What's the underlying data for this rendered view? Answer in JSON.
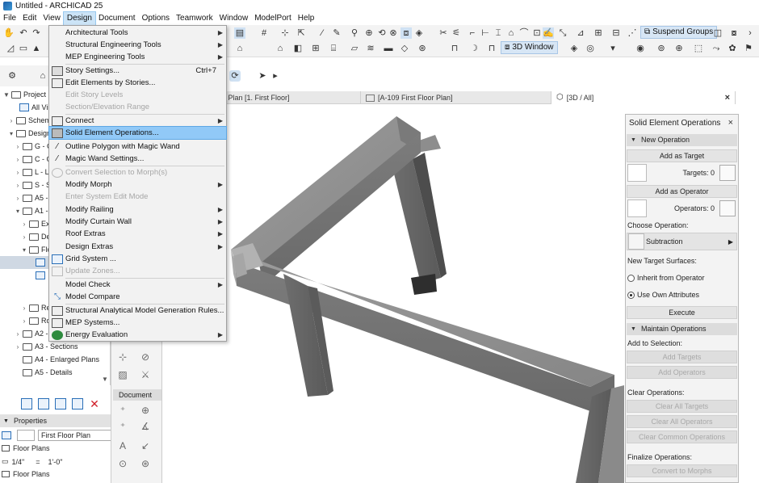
{
  "window": {
    "title": "Untitled - ARCHICAD 25"
  },
  "menubar": [
    "File",
    "Edit",
    "View",
    "Design",
    "Document",
    "Options",
    "Teamwork",
    "Window",
    "ModelPort",
    "Help"
  ],
  "menubar_active": "Design",
  "toolbar": {
    "suspend_groups": "Suspend Groups",
    "window_3d": "3D Window"
  },
  "design_menu": {
    "architectural_tools": "Architectural Tools",
    "structural_engineering_tools": "Structural Engineering Tools",
    "mep_engineering_tools": "MEP Engineering Tools",
    "story_settings": "Story Settings...",
    "story_settings_shortcut": "Ctrl+7",
    "edit_elements_by_stories": "Edit Elements by Stories...",
    "edit_story_levels": "Edit Story Levels",
    "section_elevation_range": "Section/Elevation Range",
    "connect": "Connect",
    "solid_element_operations": "Solid Element Operations...",
    "outline_polygon": "Outline Polygon with Magic Wand",
    "magic_wand_settings": "Magic Wand Settings...",
    "convert_selection_to_morphs": "Convert Selection to Morph(s)",
    "modify_morph": "Modify Morph",
    "enter_system_edit_mode": "Enter System Edit Mode",
    "modify_railing": "Modify Railing",
    "modify_curtain_wall": "Modify Curtain Wall",
    "roof_extras": "Roof Extras",
    "design_extras": "Design Extras",
    "grid_system": "Grid System ...",
    "update_zones": "Update Zones...",
    "model_check": "Model Check",
    "model_compare": "Model Compare",
    "structural_analytical": "Structural Analytical Model Generation Rules...",
    "mep_systems": "MEP Systems...",
    "energy_evaluation": "Energy Evaluation"
  },
  "navigator": {
    "rows": [
      "Project M",
      "All Visi",
      "Schem",
      "Design",
      "G - C",
      "C - C",
      "L - L",
      "S - S",
      "A5 -",
      "A1 -",
      "Ex",
      "De",
      "Flo",
      "",
      "",
      "Re",
      "Ro",
      "A2 -",
      "A3 - Sections",
      "A4 - Enlarged Plans",
      "A5 - Details"
    ]
  },
  "properties": {
    "header": "Properties",
    "name": "First Floor Plan",
    "type": "Floor Plans",
    "scale": "1/4\"",
    "scale_eq": "=",
    "scale_value": "1'-0\"",
    "type2": "Floor Plans"
  },
  "toolbox": {
    "document_label": "Document"
  },
  "tabs": {
    "first_floor": "r Plan [1. First Floor]",
    "a109": "[A-109 First Floor Plan]",
    "view3d": "[3D / All]",
    "close": "×"
  },
  "panel": {
    "title": "Solid Element Operations",
    "close": "×",
    "new_operation": "New Operation",
    "add_as_target": "Add as Target",
    "targets": "Targets: 0",
    "add_as_operator": "Add as Operator",
    "operators": "Operators: 0",
    "choose_operation": "Choose Operation:",
    "operation": "Subtraction",
    "new_target_surfaces": "New Target Surfaces:",
    "inherit": "Inherit from Operator",
    "use_own": "Use Own Attributes",
    "execute": "Execute",
    "maintain": "Maintain Operations",
    "add_to_selection": "Add to Selection:",
    "add_targets": "Add Targets",
    "add_operators": "Add Operators",
    "clear_operations": "Clear Operations:",
    "clear_all_targets": "Clear All Targets",
    "clear_all_operators": "Clear All Operators",
    "clear_common": "Clear Common Operations",
    "finalize": "Finalize Operations:",
    "convert_to_morphs": "Convert to Morphs"
  }
}
